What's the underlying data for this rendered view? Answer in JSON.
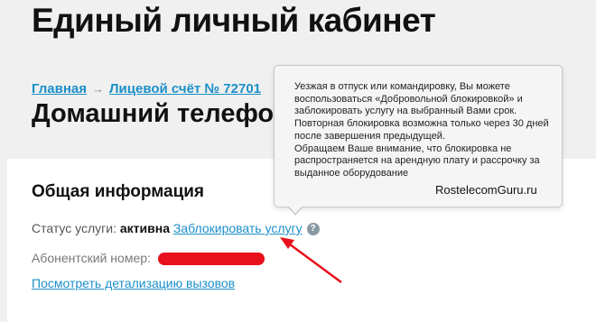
{
  "header": {
    "title": "Единый личный кабинет"
  },
  "breadcrumb": {
    "home": "Главная",
    "separator": "→",
    "account": "Лицевой счёт № 72701"
  },
  "service": {
    "title": "Домашний телефон -"
  },
  "general": {
    "heading": "Общая информация",
    "status_label": "Статус услуги:",
    "status_value": "активна",
    "block_link": "Заблокировать услугу",
    "help_icon": "?",
    "subscriber_label": "Абонентский номер:",
    "details_link": "Посмотреть детализацию вызовов"
  },
  "tooltip": {
    "text1": "Уезжая в отпуск или командировку, Вы можете воспользоваться «Добровольной блокировкой» и заблокировать услугу на выбранный Вами срок. Повторная блокировка возможна только через 30 дней после завершения предыдущей.",
    "text2": "Обращаем Ваше внимание, что блокировка не распространяется на арендную плату и рассрочку за выданное оборудование"
  },
  "watermark": "RostelecomGuru.ru",
  "colors": {
    "link": "#1b8fc9",
    "annotation": "#e8101c",
    "redaction": "#e8101c",
    "help_icon": "#8a9aa5"
  }
}
